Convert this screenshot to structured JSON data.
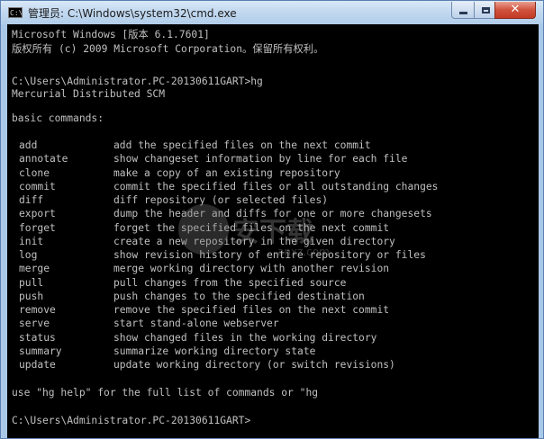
{
  "window": {
    "icon_text": "C:\\",
    "title": "管理员: C:\\Windows\\system32\\cmd.exe",
    "close_glyph": "✕"
  },
  "console": {
    "lines": [
      "Microsoft Windows [版本 6.1.7601]",
      "版权所有 (c) 2009 Microsoft Corporation。保留所有权利。",
      "",
      "C:\\Users\\Administrator.PC-20130611GART>hg",
      "Mercurial Distributed SCM",
      "",
      "basic commands:"
    ],
    "commands": [
      {
        "name": "add",
        "desc": "add the specified files on the next commit"
      },
      {
        "name": "annotate",
        "desc": "show changeset information by line for each file"
      },
      {
        "name": "clone",
        "desc": "make a copy of an existing repository"
      },
      {
        "name": "commit",
        "desc": "commit the specified files or all outstanding changes"
      },
      {
        "name": "diff",
        "desc": "diff repository (or selected files)"
      },
      {
        "name": "export",
        "desc": "dump the header and diffs for one or more changesets"
      },
      {
        "name": "forget",
        "desc": "forget the specified files on the next commit"
      },
      {
        "name": "init",
        "desc": "create a new repository in the given directory"
      },
      {
        "name": "log",
        "desc": "show revision history of entire repository or files"
      },
      {
        "name": "merge",
        "desc": "merge working directory with another revision"
      },
      {
        "name": "pull",
        "desc": "pull changes from the specified source"
      },
      {
        "name": "push",
        "desc": "push changes to the specified destination"
      },
      {
        "name": "remove",
        "desc": "remove the specified files on the next commit"
      },
      {
        "name": "serve",
        "desc": "start stand-alone webserver"
      },
      {
        "name": "status",
        "desc": "show changed files in the working directory"
      },
      {
        "name": "summary",
        "desc": "summarize working directory state"
      },
      {
        "name": "update",
        "desc": "update working directory (or switch revisions)"
      }
    ],
    "footer": "use \"hg help\" for the full list of commands or \"hg",
    "prompt": "C:\\Users\\Administrator.PC-20130611GART>"
  },
  "watermark": {
    "text": "安下载",
    "sub": "anxz.com"
  }
}
